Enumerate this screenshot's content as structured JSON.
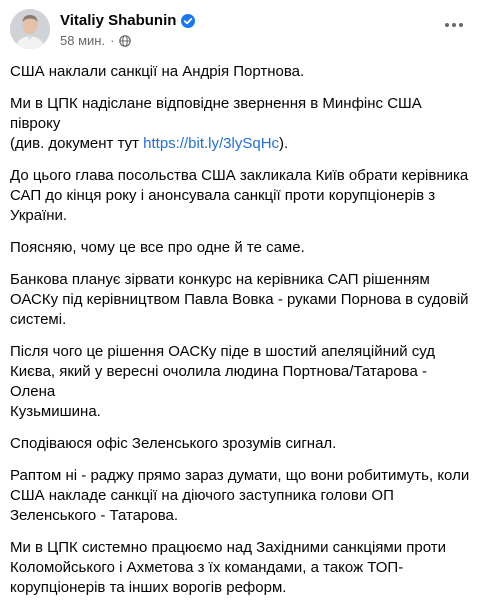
{
  "post": {
    "author": "Vitaliy Shabunin",
    "time": "58 мин.",
    "separator": "·",
    "icons": {
      "verified": "verified-badge-icon",
      "privacy": "globe-icon",
      "more": "more-options-icon"
    },
    "colors": {
      "link": "#216fdb",
      "verified": "#1877f2",
      "meta": "#65676b"
    },
    "paragraphs": [
      {
        "text": "США наклали санкції на Андрія Портнова."
      },
      {
        "before": "Ми в ЦПК надісланe відповідне звернення в Минфінс США півроку\n(див. документ тут ",
        "link": "https://bit.ly/3lySqHc",
        "after": ")."
      },
      {
        "text": "До цього глава посольства США закликала Київ обрати керівника\nСАП до кінця року і анонсувала санкції проти корупціонерів з\nУкраїни."
      },
      {
        "text": "Поясняю, чому це все про одне й те саме."
      },
      {
        "text": "Банкова планує зірвати конкурс на керівника САП рішенням\nОАСКу під керівництвом Павла Вовка - руками Порнова в судовій\nсистемі."
      },
      {
        "text": "Після чого це рішення ОАСКу піде в шостий апеляційний суд\nКиєва, який у вересні очолила людина Портнова/Татарова - Олена\nКузьмишина."
      },
      {
        "text": "Сподіваюся офіс Зеленського зрозумів сигнал."
      },
      {
        "text": "Раптом ні - раджу прямо зараз думати, що вони робитимуть, коли\nСША накладе санкції на діючого заступника голови ОП\nЗеленського - Татарова."
      },
      {
        "text": "Ми в ЦПК системно працюємо над Західними санкціями проти\nКоломойського і Ахметова з їх командами, а також ТОП-\nкорупціонерів та інших ворогів реформ."
      }
    ]
  }
}
